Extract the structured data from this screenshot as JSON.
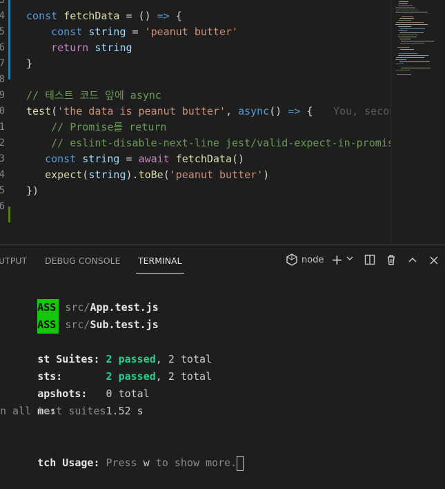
{
  "editor": {
    "line_numbers": [
      "3",
      "4",
      "5",
      "6",
      "7",
      "8",
      "9",
      "0",
      "1",
      "2",
      "3",
      "4",
      "5",
      "6"
    ],
    "lines": [
      {
        "segments": [
          {
            "t": "const ",
            "c": "kw"
          },
          {
            "t": "fetchData",
            "c": "fn"
          },
          {
            "t": " = () ",
            "c": ""
          },
          {
            "t": "=>",
            "c": "kw"
          },
          {
            "t": " {",
            "c": ""
          }
        ]
      },
      {
        "segments": [
          {
            "t": "    const ",
            "c": "kw"
          },
          {
            "t": "string",
            "c": "var"
          },
          {
            "t": " = ",
            "c": ""
          },
          {
            "t": "'peanut butter'",
            "c": "str"
          }
        ]
      },
      {
        "segments": [
          {
            "t": "    return ",
            "c": "ctl"
          },
          {
            "t": "string",
            "c": "var"
          }
        ]
      },
      {
        "segments": [
          {
            "t": "}",
            "c": ""
          }
        ]
      },
      {
        "segments": []
      },
      {
        "segments": [
          {
            "t": "// 테스트 코드 앞에 async",
            "c": "cm"
          }
        ]
      },
      {
        "segments": [
          {
            "t": "test",
            "c": "fn"
          },
          {
            "t": "(",
            "c": ""
          },
          {
            "t": "'the data is peanut butter'",
            "c": "str"
          },
          {
            "t": ", ",
            "c": ""
          },
          {
            "t": "async",
            "c": "kw"
          },
          {
            "t": "() ",
            "c": ""
          },
          {
            "t": "=>",
            "c": "kw"
          },
          {
            "t": " {",
            "c": ""
          }
        ]
      },
      {
        "segments": [
          {
            "t": "    // Promise를 return",
            "c": "cm"
          }
        ]
      },
      {
        "segments": [
          {
            "t": "    // eslint-disable-next-line jest/valid-expect-in-promise",
            "c": "cm"
          }
        ]
      },
      {
        "segments": [
          {
            "t": "   const ",
            "c": "kw"
          },
          {
            "t": "string",
            "c": "var"
          },
          {
            "t": " = ",
            "c": ""
          },
          {
            "t": "await ",
            "c": "ctl"
          },
          {
            "t": "fetchData",
            "c": "fn"
          },
          {
            "t": "()",
            "c": ""
          }
        ]
      },
      {
        "segments": [
          {
            "t": "   expect",
            "c": "fn"
          },
          {
            "t": "(",
            "c": ""
          },
          {
            "t": "string",
            "c": "var"
          },
          {
            "t": ").",
            "c": ""
          },
          {
            "t": "toBe",
            "c": "fn"
          },
          {
            "t": "(",
            "c": ""
          },
          {
            "t": "'peanut butter'",
            "c": "str"
          },
          {
            "t": ")",
            "c": ""
          }
        ]
      },
      {
        "segments": [
          {
            "t": "})",
            "c": ""
          }
        ]
      },
      {
        "segments": []
      }
    ],
    "blame_text": "You, secon",
    "colors": {
      "accent": "#007acc",
      "modified": "#1b81a8",
      "added": "#587c0c"
    }
  },
  "panel": {
    "tabs": [
      "UTPUT",
      "DEBUG CONSOLE",
      "TERMINAL"
    ],
    "terminal_name": "node",
    "icons": [
      "terminal-icon",
      "plus-icon",
      "chevron-down-icon",
      "split-icon",
      "trash-icon",
      "chevron-up-icon",
      "close-icon"
    ],
    "terminal": {
      "pass_badge": "ASS",
      "results": [
        {
          "dir": "src/",
          "file": "App.test.js"
        },
        {
          "dir": "src/",
          "file": "Sub.test.js"
        }
      ],
      "suites_label": "st Suites:",
      "suites_passed": "2 passed",
      "suites_total": ", 2 total",
      "tests_label": "sts:",
      "tests_passed": "2 passed",
      "tests_total": ", 2 total",
      "snapshots_label": "apshots:",
      "snapshots_value": "0 total",
      "time_label": "me:",
      "time_value": "1.52 s",
      "ran_text": "n all test suites.",
      "watch_label": "tch Usage:",
      "watch_prefix": " Press ",
      "watch_key": "w",
      "watch_suffix": " to show more."
    }
  }
}
